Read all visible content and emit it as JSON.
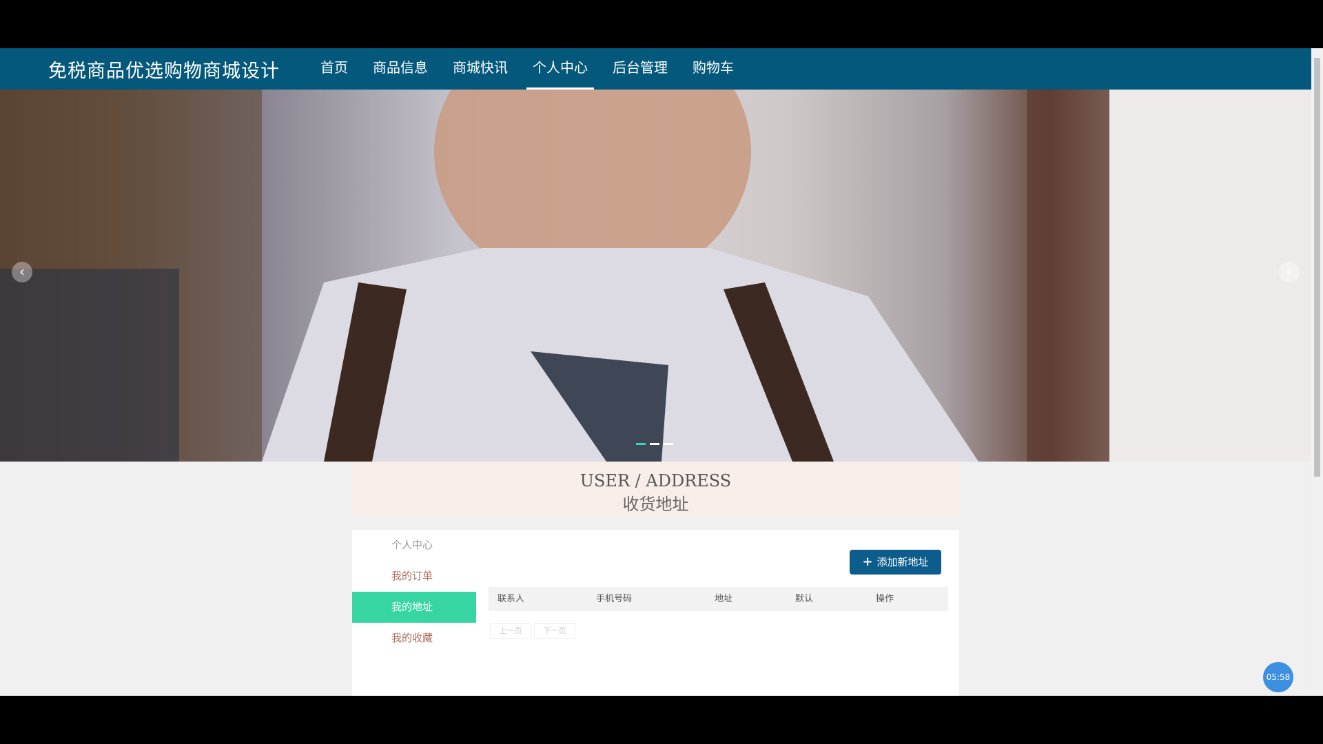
{
  "navbar": {
    "brand": "免税商品优选购物商城设计",
    "items": [
      {
        "label": "首页"
      },
      {
        "label": "商品信息"
      },
      {
        "label": "商城快讯"
      },
      {
        "label": "个人中心"
      },
      {
        "label": "后台管理"
      },
      {
        "label": "购物车"
      }
    ],
    "active_item": "个人中心"
  },
  "banner": {
    "prev_icon": "‹",
    "next_icon": "›",
    "slide_count": 3,
    "active_slide": 1
  },
  "section": {
    "title_en": "USER / ADDRESS",
    "title_cn": "收货地址"
  },
  "sidebar": {
    "items": [
      {
        "label": "个人中心"
      },
      {
        "label": "我的订单"
      },
      {
        "label": "我的地址"
      },
      {
        "label": "我的收藏"
      }
    ],
    "active_item": "我的地址"
  },
  "actions": {
    "add_icon": "+",
    "add_label": "添加新地址"
  },
  "table": {
    "headers": [
      "联系人",
      "手机号码",
      "地址",
      "默认",
      "操作"
    ],
    "rows": []
  },
  "pagination": {
    "prev_label": "上一页",
    "next_label": "下一页"
  },
  "overlay": {
    "timer": "05:58"
  },
  "colors": {
    "navbar": "#03587b",
    "sidebar_active": "#37d5a2",
    "add_button": "#0d5d8c",
    "title_bg": "#f8eee9",
    "timer_bg": "#3d8fe0"
  }
}
